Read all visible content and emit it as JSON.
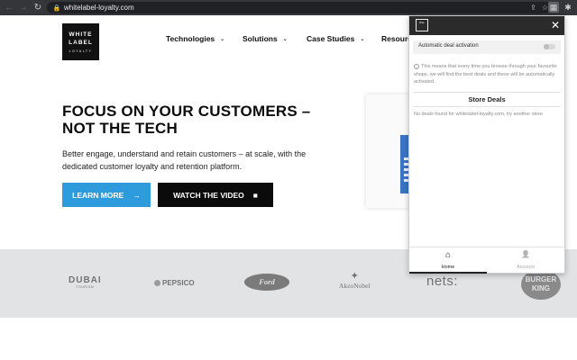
{
  "browser": {
    "back": "←",
    "forward": "→",
    "reload": "↻",
    "lock": "🔒",
    "url": "whitelabel-loyalty.com",
    "share": "⇪",
    "bookmark": "☆",
    "ext_active": "▦",
    "ext_puzzle": "✱"
  },
  "site": {
    "logo": {
      "line1": "WHITE",
      "line2": "LABEL",
      "line3": "LOYALTY"
    },
    "nav": [
      {
        "label": "Technologies",
        "chev": "⌄"
      },
      {
        "label": "Solutions",
        "chev": "⌄"
      },
      {
        "label": "Case Studies",
        "chev": "⌄"
      },
      {
        "label": "Resource"
      }
    ],
    "hero": {
      "title": "FOCUS ON YOUR CUSTOMERS – NOT THE TECH",
      "subtitle": "Better engage, understand and retain customers – at scale, with the dedicated customer loyalty and retention platform.",
      "learn_more": "LEARN MORE",
      "learn_more_icon": "→",
      "watch_video": "WATCH THE VIDEO",
      "watch_video_icon": "■"
    },
    "brands": {
      "dubai": "DUBAI",
      "dubai_small": "TOURISM",
      "pepsico": "PEPSICO",
      "ford": "Ford",
      "akzo_mark": "✦",
      "akzo": "AkzoNobel",
      "nets": "nets:",
      "bk": "BURGER KING"
    }
  },
  "popup": {
    "logo": "WLL",
    "close": "✕",
    "toggle_label": "Automatic deal activation",
    "toggle_on": false,
    "info_icon": "i",
    "info_text": "This means that every time you browse through your favourite shops, we will find the best deals and these will be automatically activated.",
    "deals_title": "Store Deals",
    "deals_message": "No deals found for whitelabel-loyalty.com, try another store",
    "footer": {
      "home_icon": "⌂",
      "home": "Home",
      "account_icon": "👤",
      "account": "Account"
    }
  }
}
